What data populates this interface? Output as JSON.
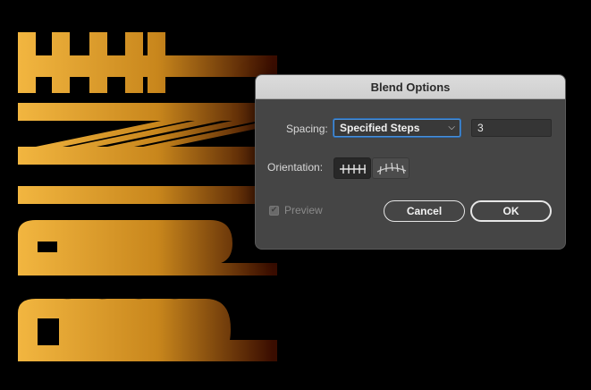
{
  "dialog": {
    "title": "Blend Options",
    "spacing_label": "Spacing:",
    "spacing_value": "Specified Steps",
    "steps_value": "3",
    "orientation_label": "Orientation:",
    "orientation_selected": "align-to-page",
    "preview_label": "Preview",
    "preview_checked": true,
    "preview_enabled": false,
    "cancel_label": "Cancel",
    "ok_label": "OK"
  },
  "artwork": {
    "gradient_start": "#f2b640",
    "gradient_mid": "#c8861c",
    "gradient_end": "#3a0d00",
    "background": "#000000"
  }
}
